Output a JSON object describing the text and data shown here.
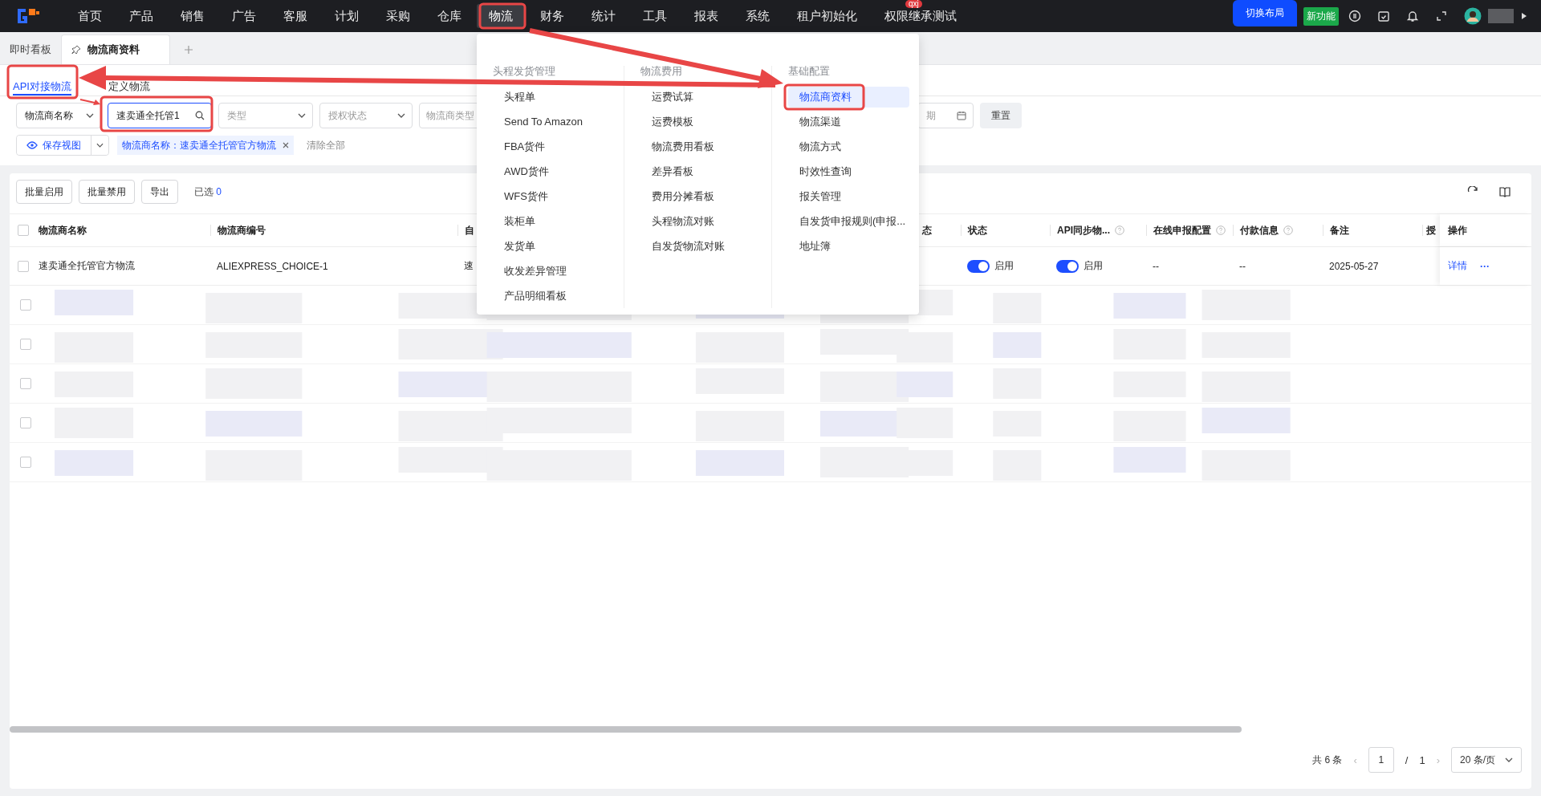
{
  "top_nav": {
    "items": [
      {
        "label": "首页",
        "selected": false
      },
      {
        "label": "产品",
        "selected": false
      },
      {
        "label": "销售",
        "selected": false
      },
      {
        "label": "广告",
        "selected": false
      },
      {
        "label": "客服",
        "selected": false
      },
      {
        "label": "计划",
        "selected": false
      },
      {
        "label": "采购",
        "selected": false
      },
      {
        "label": "仓库",
        "selected": false
      },
      {
        "label": "物流",
        "selected": true
      },
      {
        "label": "财务",
        "selected": false
      },
      {
        "label": "统计",
        "selected": false
      },
      {
        "label": "工具",
        "selected": false
      },
      {
        "label": "报表",
        "selected": false
      },
      {
        "label": "系统",
        "selected": false
      },
      {
        "label": "租户初始化",
        "selected": false
      },
      {
        "label": "权限继承测试",
        "selected": false,
        "badge": "qxj"
      }
    ],
    "layout_button": "切换布局",
    "new_feature_badge": "新功能"
  },
  "page_tabs": [
    {
      "label": "即时看板",
      "selected": false,
      "pinned": false
    },
    {
      "label": "物流商资料",
      "selected": true,
      "pinned": true
    }
  ],
  "sub_tabs": [
    {
      "label": "API对接物流",
      "selected": true
    },
    {
      "label": "定义物流",
      "selected": false
    }
  ],
  "filters": [
    {
      "kind": "select",
      "value": "物流商名称"
    },
    {
      "kind": "search",
      "value": "速卖通全托管1"
    },
    {
      "kind": "select",
      "placeholder": "类型"
    },
    {
      "kind": "select",
      "placeholder": "授权状态"
    },
    {
      "kind": "select",
      "placeholder": "物流商类型"
    },
    {
      "kind": "date",
      "placeholder": "期"
    }
  ],
  "reset_button": "重置",
  "save_view_button": "保存视图",
  "active_filter": "物流商名称：速卖通全托管官方物流",
  "clear_all": "清除全部",
  "actions": [
    "批量启用",
    "批量禁用",
    "导出"
  ],
  "selected_count": {
    "label": "已选",
    "value": "0"
  },
  "table": {
    "all_checked": false,
    "columns": [
      {
        "label": "物流商名称",
        "help": false
      },
      {
        "label": "物流商编号",
        "help": false
      },
      {
        "label": "自",
        "help": false
      },
      {
        "label": "态",
        "help": false
      },
      {
        "label": "状态",
        "help": false
      },
      {
        "label": "API同步物...",
        "help": true
      },
      {
        "label": "在线申报配置",
        "help": true
      },
      {
        "label": "付款信息",
        "help": true
      },
      {
        "label": "备注",
        "help": false
      },
      {
        "label": "授",
        "help": false
      },
      {
        "label": "操作",
        "help": false
      }
    ],
    "rows": [
      {
        "checked": false,
        "name": "速卖通全托管官方物流",
        "code": "ALIEXPRESS_CHOICE-1",
        "column_3": "速",
        "status": {
          "on": true,
          "label": "启用"
        },
        "api_sync": {
          "on": true,
          "label": "启用"
        },
        "online_declaration": "--",
        "payment_info": "--",
        "remarks": "2025-05-27",
        "detail_link": "详情",
        "more": "···"
      }
    ],
    "blurred_rows": [
      {
        "checked": false
      },
      {
        "checked": false
      },
      {
        "checked": false
      },
      {
        "checked": false
      },
      {
        "checked": false
      }
    ]
  },
  "pagination": {
    "total": "共 6 条",
    "prev": "‹",
    "page": "1",
    "separator": "/",
    "pages": "1",
    "next": "›",
    "page_size": "20 条/页"
  },
  "menu": {
    "columns": [
      {
        "title": "头程发货管理",
        "items": [
          {
            "label": "头程单",
            "selected": false
          },
          {
            "label": "Send To Amazon",
            "selected": false
          },
          {
            "label": "FBA货件",
            "selected": false
          },
          {
            "label": "AWD货件",
            "selected": false
          },
          {
            "label": "WFS货件",
            "selected": false
          },
          {
            "label": "装柜单",
            "selected": false
          },
          {
            "label": "发货单",
            "selected": false
          },
          {
            "label": "收发差异管理",
            "selected": false
          },
          {
            "label": "产品明细看板",
            "selected": false
          }
        ]
      },
      {
        "title": "物流费用",
        "items": [
          {
            "label": "运费试算",
            "selected": false
          },
          {
            "label": "运费模板",
            "selected": false
          },
          {
            "label": "物流费用看板",
            "selected": false
          },
          {
            "label": "差异看板",
            "selected": false
          },
          {
            "label": "费用分摊看板",
            "selected": false
          },
          {
            "label": "头程物流对账",
            "selected": false
          },
          {
            "label": "自发货物流对账",
            "selected": false
          }
        ]
      },
      {
        "title": "基础配置",
        "items": [
          {
            "label": "物流商资料",
            "selected": true
          },
          {
            "label": "物流渠道",
            "selected": false
          },
          {
            "label": "物流方式",
            "selected": false
          },
          {
            "label": "时效性查询",
            "selected": false
          },
          {
            "label": "报关管理",
            "selected": false
          },
          {
            "label": "自发货申报规则(申报...",
            "selected": false
          },
          {
            "label": "地址簿",
            "selected": false
          }
        ]
      }
    ]
  }
}
